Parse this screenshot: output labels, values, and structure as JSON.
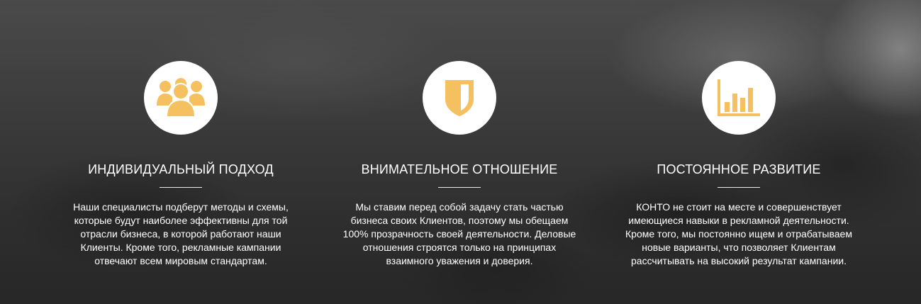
{
  "accent_color": "#f4c060",
  "features": [
    {
      "icon": "team-icon",
      "title": "ИНДИВИДУАЛЬНЫЙ ПОДХОД",
      "lines": [
        "Наши специалисты подберут методы и схемы,",
        "которые будут наиболее эффективны для той",
        "отрасли бизнеса, в которой работают наши",
        "Клиенты. Кроме того, рекламные кампании",
        "отвечают всем мировым стандартам."
      ]
    },
    {
      "icon": "shield-icon",
      "title": "ВНИМАТЕЛЬНОЕ ОТНОШЕНИЕ",
      "lines": [
        "Мы ставим перед собой задачу стать частью",
        "бизнеса своих Клиентов, поэтому мы обещаем",
        "100% прозрачность своей деятельности. Деловые",
        "отношения строятся только на принципах",
        "взаимного уважения и доверия."
      ]
    },
    {
      "icon": "bar-chart-icon",
      "title": "ПОСТОЯННОЕ РАЗВИТИЕ",
      "lines": [
        "КОНТО не стоит на месте и совершенствует",
        "имеющиеся навыки в рекламной деятельности.",
        "Кроме того, мы постоянно ищем и отрабатываем",
        "новые варианты, что позволяет Клиентам",
        "рассчитывать на высокий результат кампании."
      ]
    }
  ]
}
